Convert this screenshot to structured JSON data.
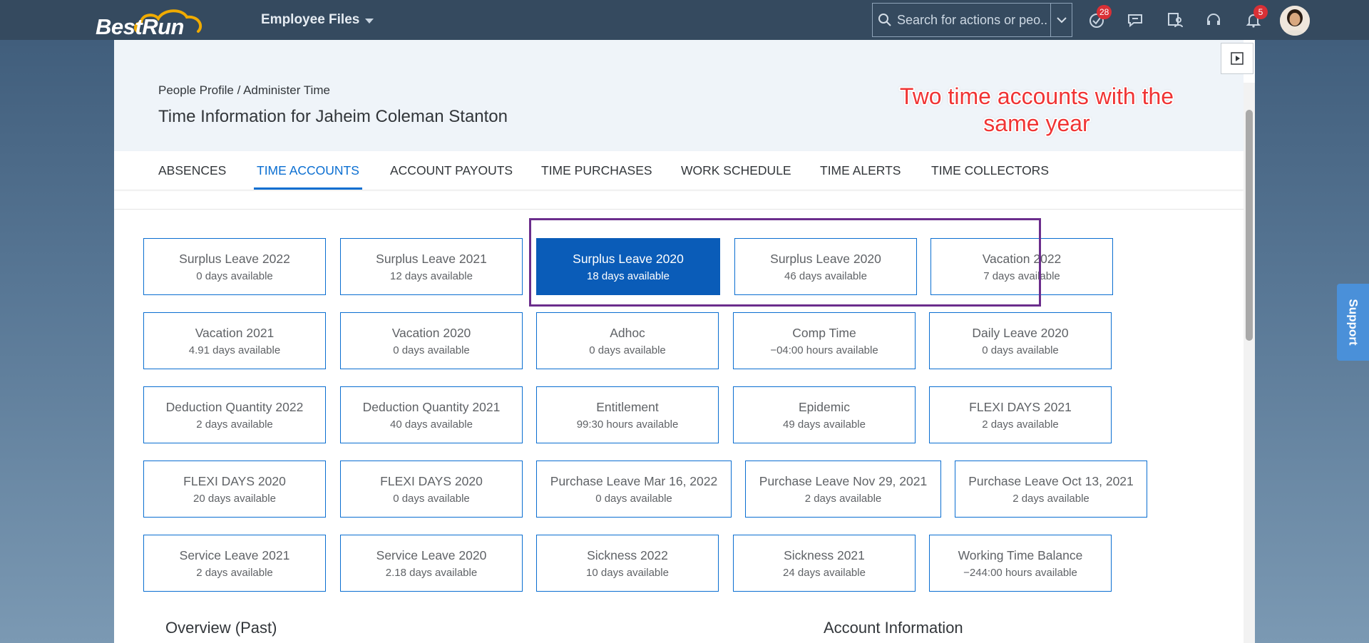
{
  "shell": {
    "logo_text": "BestRun",
    "app_title": "Employee Files",
    "search_placeholder": "Search for actions or peo...",
    "todo_badge": "28",
    "notification_badge": "5"
  },
  "page": {
    "breadcrumb": {
      "part1": "People Profile",
      "separator": " / ",
      "part2": "Administer Time"
    },
    "title": "Time Information for Jaheim Coleman Stanton",
    "annotation": {
      "line1": "Two time accounts with the",
      "line2": "same year"
    }
  },
  "tabs": [
    "ABSENCES",
    "TIME ACCOUNTS",
    "ACCOUNT PAYOUTS",
    "TIME PURCHASES",
    "WORK SCHEDULE",
    "TIME ALERTS",
    "TIME COLLECTORS"
  ],
  "active_tab": "TIME ACCOUNTS",
  "tiles": [
    {
      "name": "Surplus Leave 2022",
      "available": "0 days available"
    },
    {
      "name": "Surplus Leave 2021",
      "available": "12 days available"
    },
    {
      "name": "Surplus Leave 2020",
      "available": "18 days available",
      "selected": true
    },
    {
      "name": "Surplus Leave 2020",
      "available": "46 days available"
    },
    {
      "name": "Vacation 2022",
      "available": "7 days available"
    },
    {
      "name": "Vacation 2021",
      "available": "4.91 days available"
    },
    {
      "name": "Vacation 2020",
      "available": "0 days available"
    },
    {
      "name": "Adhoc",
      "available": "0 days available"
    },
    {
      "name": "Comp Time",
      "available": "−04:00 hours available"
    },
    {
      "name": "Daily Leave 2020",
      "available": "0 days available"
    },
    {
      "name": "Deduction Quantity 2022",
      "available": "2 days available"
    },
    {
      "name": "Deduction Quantity 2021",
      "available": "40 days available"
    },
    {
      "name": "Entitlement",
      "available": "99:30 hours available"
    },
    {
      "name": "Epidemic",
      "available": "49 days available"
    },
    {
      "name": "FLEXI DAYS 2021",
      "available": "2 days available"
    },
    {
      "name": "FLEXI DAYS 2020",
      "available": "20 days available"
    },
    {
      "name": "FLEXI DAYS 2020",
      "available": "0 days available"
    },
    {
      "name": "Purchase Leave Mar 16, 2022",
      "available": "0 days available"
    },
    {
      "name": "Purchase Leave Nov 29, 2021",
      "available": "2 days available"
    },
    {
      "name": "Purchase Leave Oct 13, 2021",
      "available": "2 days available"
    },
    {
      "name": "Service Leave 2021",
      "available": "2 days available"
    },
    {
      "name": "Service Leave 2020",
      "available": "2.18 days available"
    },
    {
      "name": "Sickness 2022",
      "available": "10 days available"
    },
    {
      "name": "Sickness 2021",
      "available": "24 days available"
    },
    {
      "name": "Working Time Balance",
      "available": "−244:00 hours available"
    }
  ],
  "sections": {
    "overview": "Overview (Past)",
    "account_info": "Account Information"
  },
  "support_label": "Support",
  "colors": {
    "shell": "#354a5f",
    "accent": "#0a6ed1",
    "selected_tile": "#0a5cb8",
    "annotation": "#f03434",
    "highlight_box": "#6b2d8c"
  }
}
